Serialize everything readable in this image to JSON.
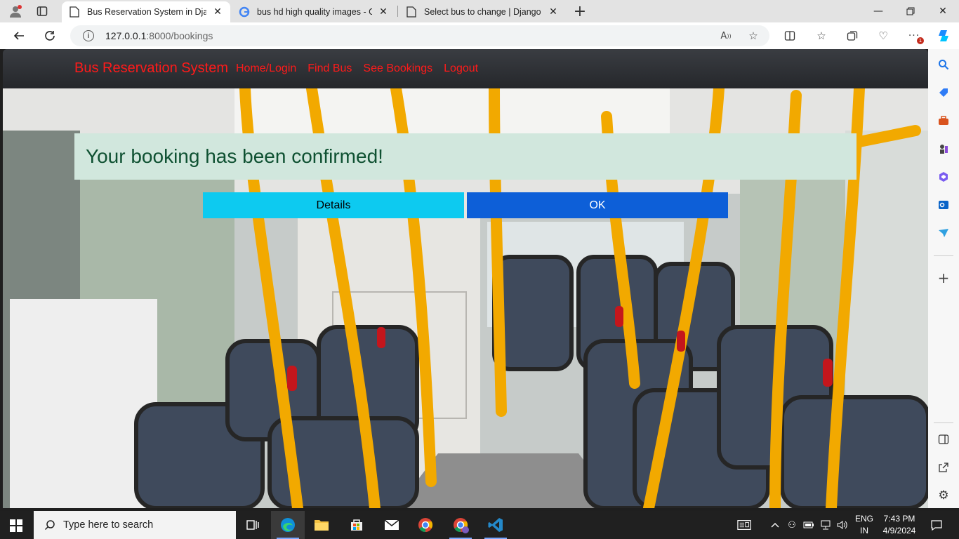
{
  "browser": {
    "tabs": [
      {
        "title": "Bus Reservation System in Django",
        "active": true
      },
      {
        "title": "bus hd high quality images - Google",
        "active": false
      },
      {
        "title": "Select bus to change | Django site",
        "active": false
      }
    ],
    "address": {
      "host": "127.0.0.1",
      "path": ":8000/bookings"
    }
  },
  "site": {
    "brand": "Bus Reservation System",
    "links": [
      "Home/Login",
      "Find Bus",
      "See Bookings",
      "Logout"
    ],
    "alert": "Your booking has been confirmed!",
    "buttons": {
      "details": "Details",
      "ok": "OK"
    }
  },
  "taskbar": {
    "search_placeholder": "Type here to search",
    "lang_line1": "ENG",
    "lang_line2": "IN",
    "time": "7:43 PM",
    "date": "4/9/2024"
  },
  "colors": {
    "brand_red": "#ff1a1a",
    "alert_bg": "#d1e7dd",
    "alert_text": "#0f5132",
    "details_btn": "#0dcaf0",
    "ok_btn": "#0d5fd8"
  }
}
